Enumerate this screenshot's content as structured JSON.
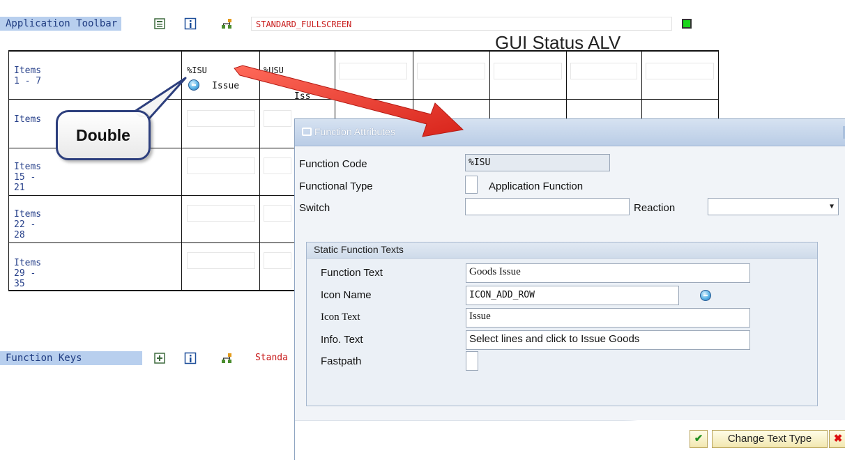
{
  "app_toolbar": {
    "label": "Application Toolbar",
    "status_name": "STANDARD_FULLSCREEN",
    "title": "GUI Status ALV"
  },
  "grid": {
    "rows": [
      "Items  1 -  7",
      "Items",
      "Items 15 - 21",
      "Items 22 - 28",
      "Items 29 - 35"
    ],
    "cells": [
      {
        "code": "%ISU",
        "icon_text": "Issue"
      },
      {
        "code": "%USU",
        "icon_text": "Un Iss"
      }
    ]
  },
  "callout": {
    "text": "Double"
  },
  "function_keys": {
    "label": "Function Keys",
    "status_name": "Standa"
  },
  "dialog": {
    "title": "Function Attributes",
    "function_code_label": "Function Code",
    "function_code_value": "%ISU",
    "functional_type_label": "Functional Type",
    "functional_type_value": "Application Function",
    "switch_label": "Switch",
    "reaction_label": "Reaction",
    "group_title": "Static Function Texts",
    "function_text_label": "Function Text",
    "function_text_value": "Goods Issue",
    "icon_name_label": "Icon Name",
    "icon_name_value": "ICON_ADD_ROW",
    "icon_text_label": "Icon Text",
    "icon_text_value": "Issue",
    "info_text_label": "Info. Text",
    "info_text_value": "Select lines and click to Issue Goods",
    "fastpath_label": "Fastpath",
    "change_text_type_label": "Change Text Type"
  },
  "colors": {
    "accent_red": "#e8322b",
    "label_bar": "#b8cfee",
    "status_red": "#c81b1b"
  }
}
